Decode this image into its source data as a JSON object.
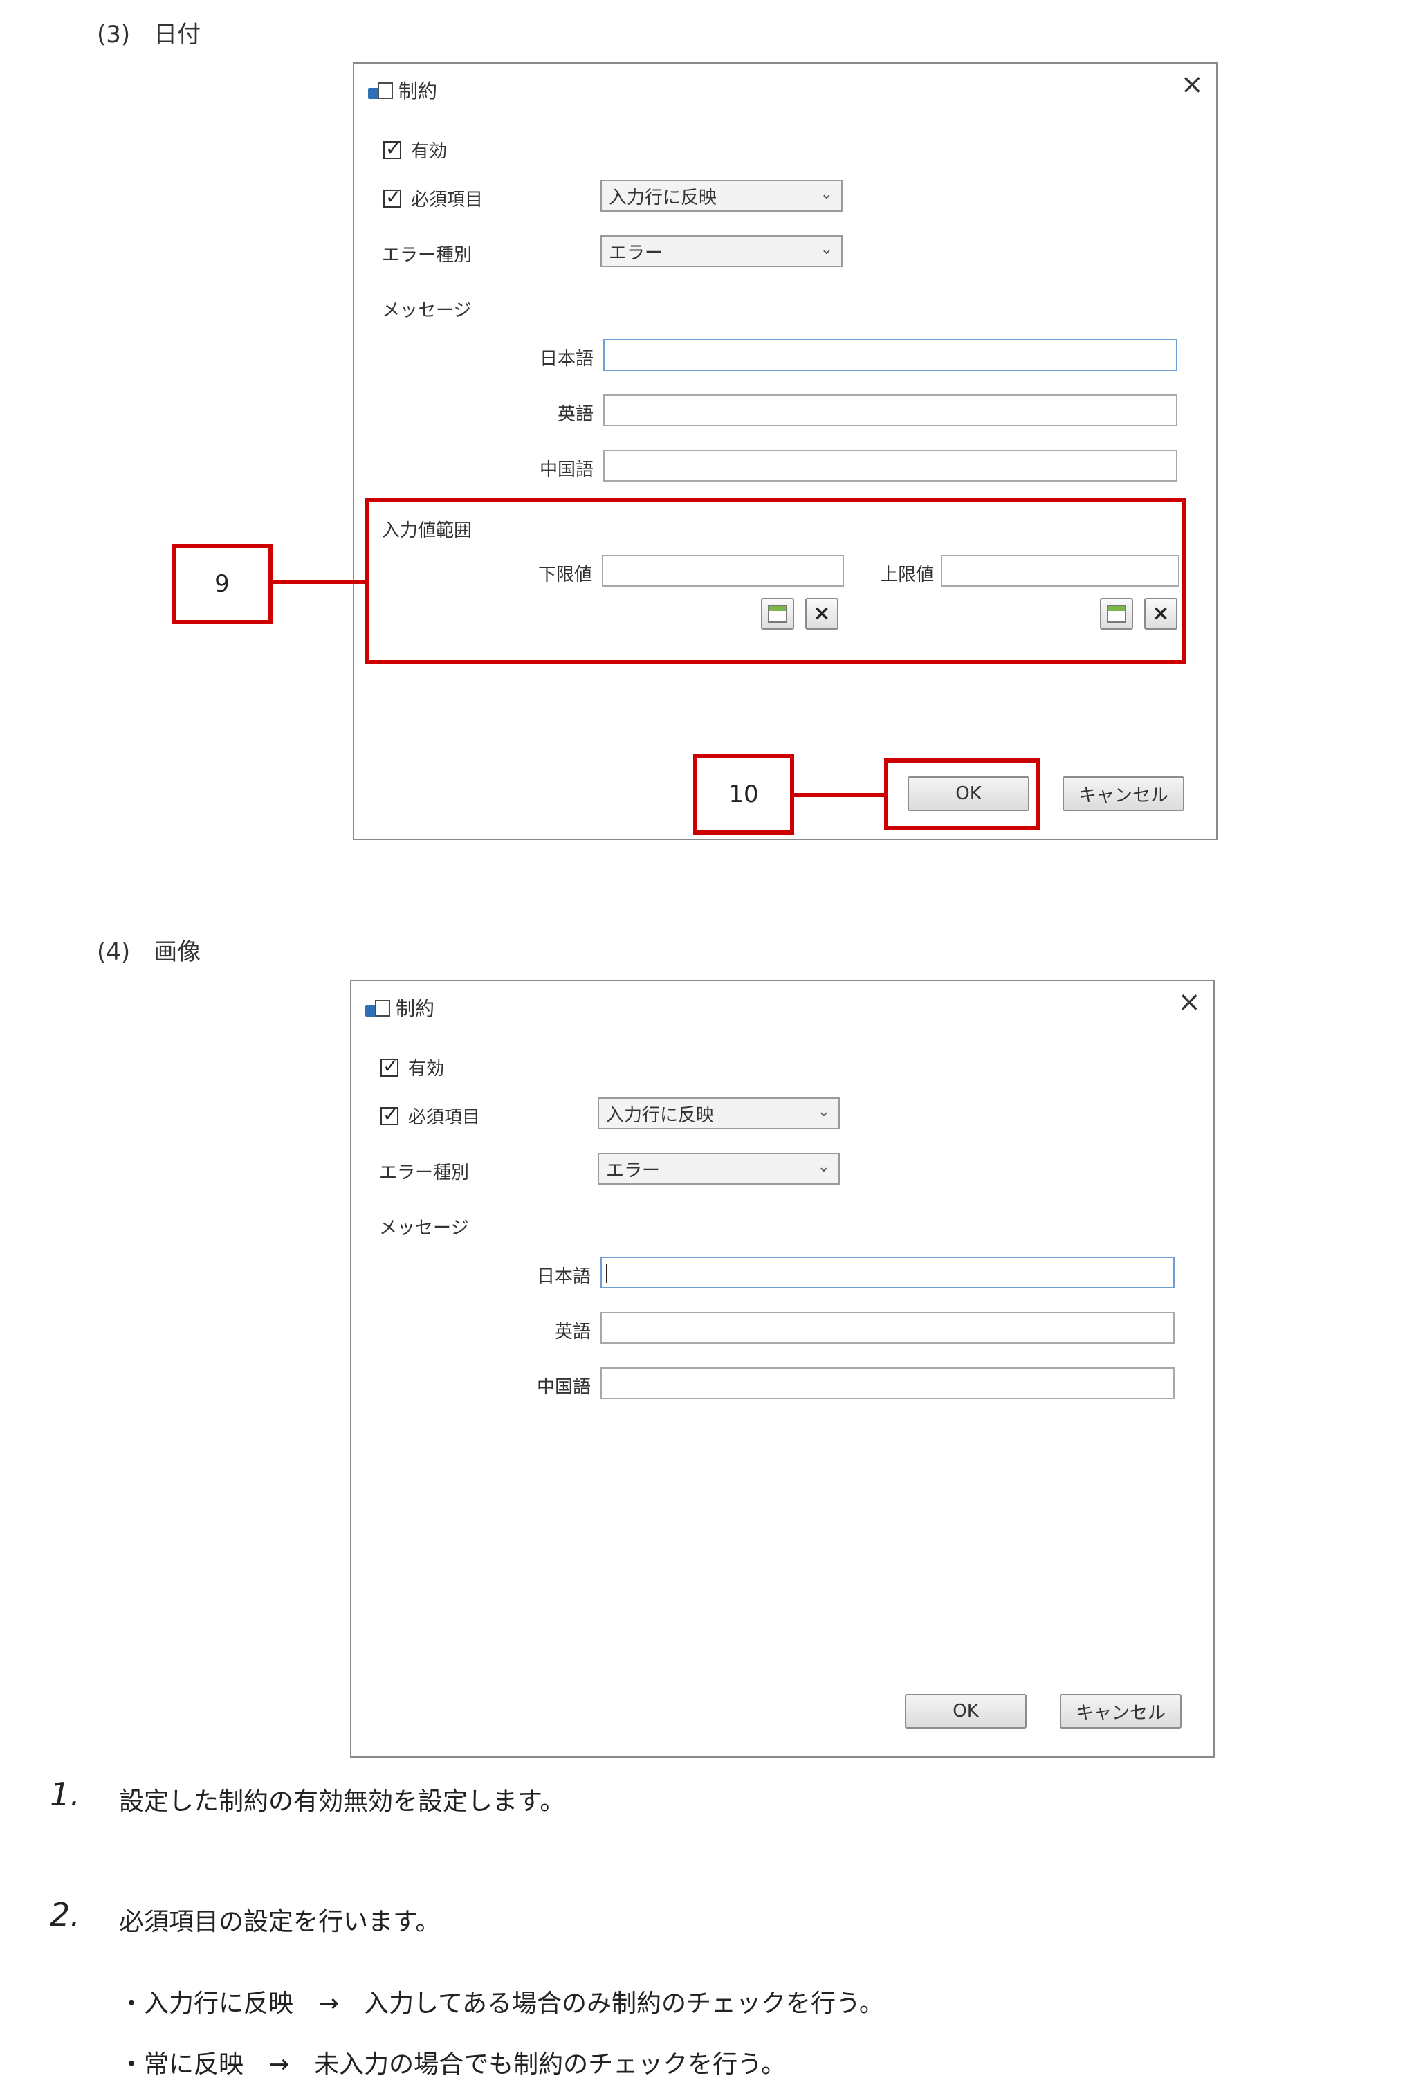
{
  "section3": {
    "label": "(3)　日付"
  },
  "section4": {
    "label": "(4)　画像"
  },
  "dialog": {
    "title": "制約",
    "close_icon": "close-icon",
    "enabled_label": "有効",
    "required_label": "必須項目",
    "required_select_value": "入力行に反映",
    "error_type_label": "エラー種別",
    "error_type_value": "エラー",
    "message_label": "メッセージ",
    "lang_japanese": "日本語",
    "lang_english": "英語",
    "lang_chinese": "中国語",
    "range_label": "入力値範囲",
    "lower_label": "下限値",
    "upper_label": "上限値",
    "ok_label": "OK",
    "cancel_label": "キャンセル"
  },
  "callouts": {
    "nine": "9",
    "ten": "10"
  },
  "list": [
    {
      "number": "1.",
      "text": "設定した制約の有効無効を設定します。"
    },
    {
      "number": "2.",
      "text": "必須項目の設定を行います。"
    }
  ],
  "bullets": [
    "・入力行に反映　→　入力してある場合のみ制約のチェックを行う。",
    "・常に反映　→　未入力の場合でも制約のチェックを行う。"
  ],
  "colors": {
    "accent_red": "#cc0000",
    "focus_blue": "#6e9ed3",
    "calendar_green": "#7ab648"
  }
}
